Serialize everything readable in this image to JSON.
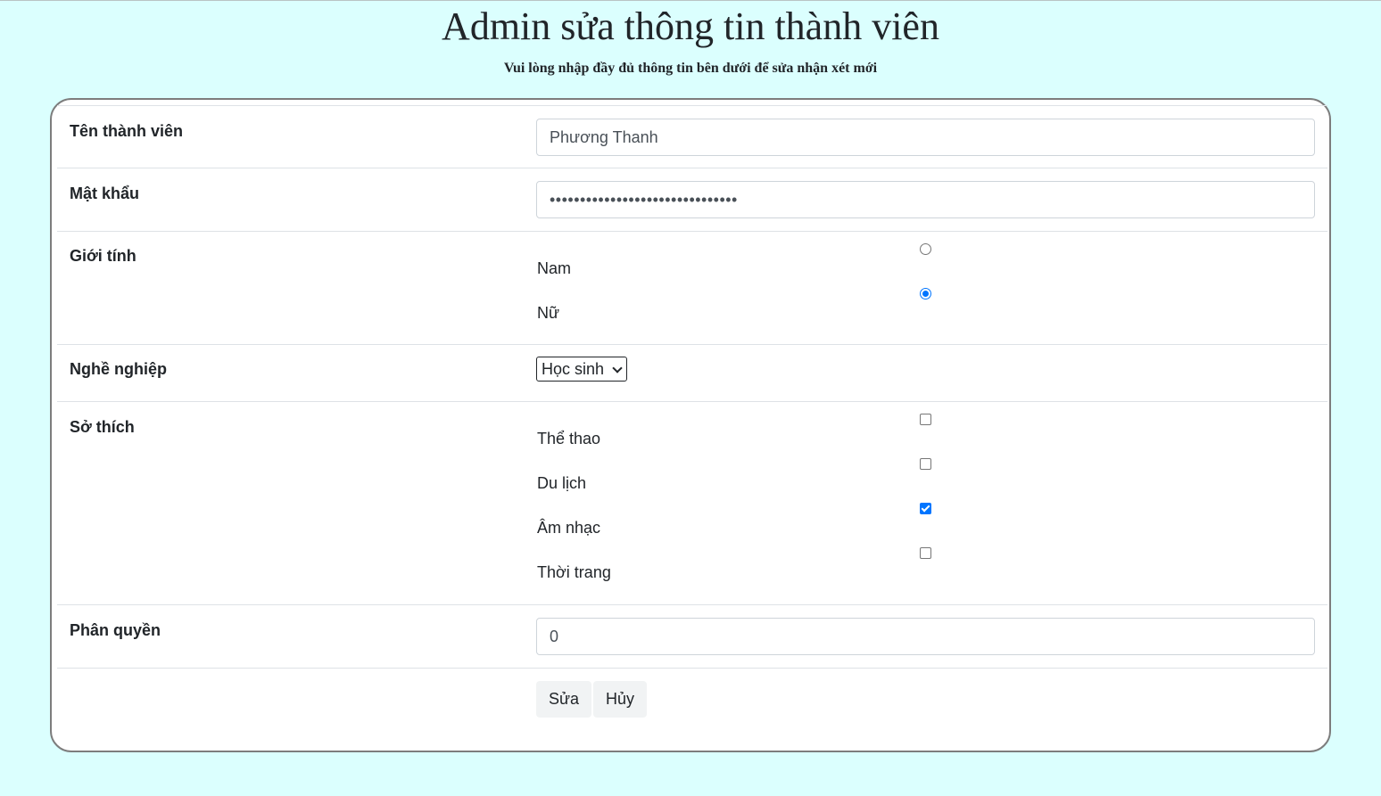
{
  "page": {
    "title": "Admin sửa thông tin thành viên",
    "subtitle": "Vui lòng nhập đầy đủ thông tin bên dưới để sửa nhận xét mới"
  },
  "form": {
    "username": {
      "label": "Tên thành viên",
      "value": "Phương Thanh"
    },
    "password": {
      "label": "Mật khẩu",
      "masked_value": "•••••••••••••••••••••••••••••••"
    },
    "gender": {
      "label": "Giới tính",
      "options": [
        {
          "label": "Nam",
          "checked": false
        },
        {
          "label": "Nữ",
          "checked": true
        }
      ]
    },
    "occupation": {
      "label": "Nghề nghiệp",
      "selected": "Học sinh"
    },
    "hobbies": {
      "label": "Sở thích",
      "options": [
        {
          "label": "Thể thao",
          "checked": false
        },
        {
          "label": "Du lịch",
          "checked": false
        },
        {
          "label": "Âm nhạc",
          "checked": true
        },
        {
          "label": "Thời trang",
          "checked": false
        }
      ]
    },
    "role": {
      "label": "Phân quyền",
      "value": "0"
    },
    "buttons": {
      "submit": "Sửa",
      "cancel": "Hủy"
    }
  },
  "colors": {
    "page_background": "#dbfffe",
    "accent": "#0075ff",
    "card_border": "#7d7d7d"
  }
}
